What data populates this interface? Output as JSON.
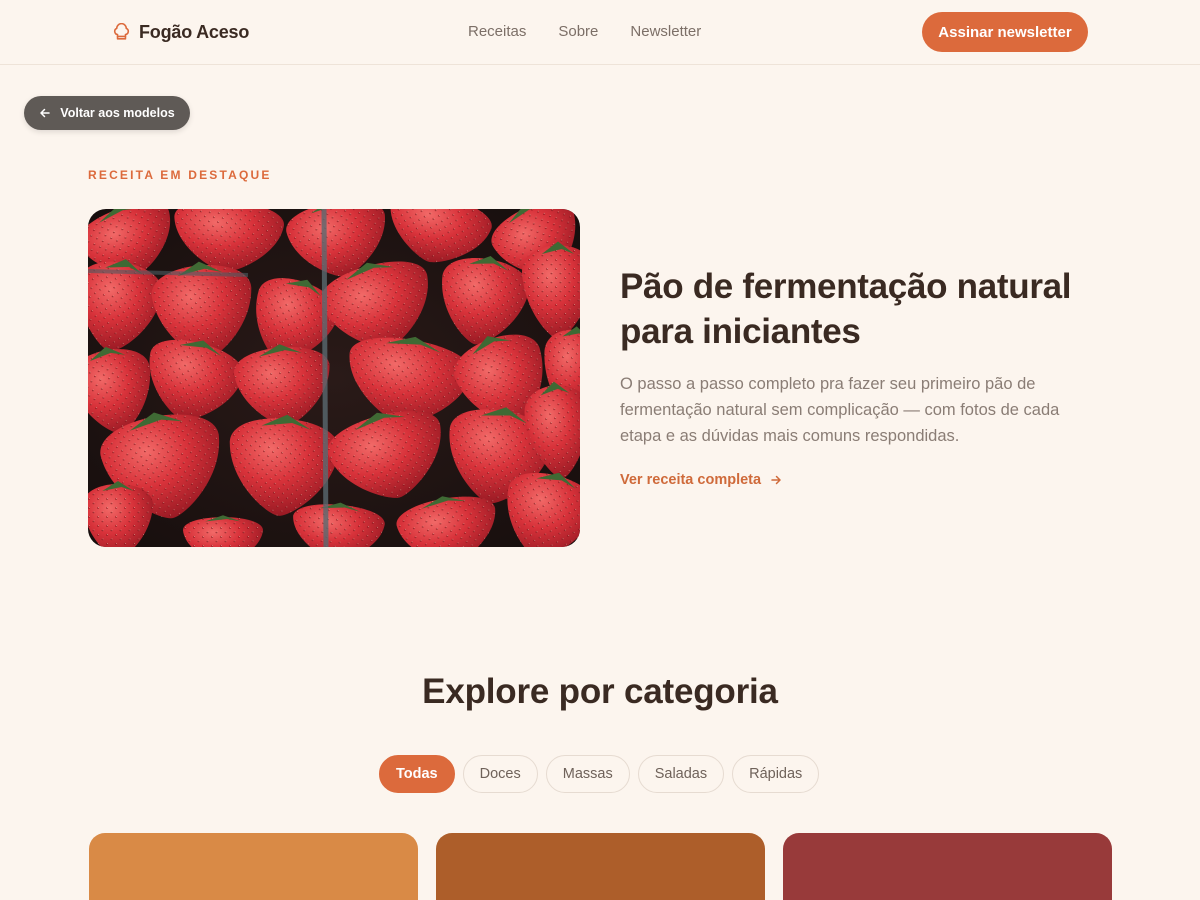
{
  "header": {
    "brand": "Fogão Aceso",
    "brand_icon": "chef-hat-icon",
    "nav": [
      "Receitas",
      "Sobre",
      "Newsletter"
    ],
    "cta_label": "Assinar newsletter"
  },
  "back_button": {
    "label": "Voltar aos modelos",
    "icon": "arrow-left-icon"
  },
  "featured": {
    "eyebrow": "RECEITA EM DESTAQUE",
    "image_subject": "strawberries",
    "title": "Pão de fermentação natural para iniciantes",
    "description": "O passo a passo completo pra fazer seu primeiro pão de fermentação natural sem complicação — com fotos de cada etapa e as dúvidas mais comuns respondidas.",
    "link_label": "Ver receita completa",
    "link_icon": "arrow-right-icon"
  },
  "categories": {
    "title": "Explore por categoria",
    "chips": [
      {
        "label": "Todas",
        "active": true
      },
      {
        "label": "Doces",
        "active": false
      },
      {
        "label": "Massas",
        "active": false
      },
      {
        "label": "Saladas",
        "active": false
      },
      {
        "label": "Rápidas",
        "active": false
      }
    ]
  },
  "cards": [
    {
      "color": "#d98a46"
    },
    {
      "color": "#ad5e2a"
    },
    {
      "color": "#983a3a"
    }
  ],
  "colors": {
    "background": "#fcf5ee",
    "accent": "#dc6a3c",
    "text_dark": "#3a2a22",
    "text_muted": "#8a7d75",
    "back_button_bg": "#5f5a56"
  }
}
